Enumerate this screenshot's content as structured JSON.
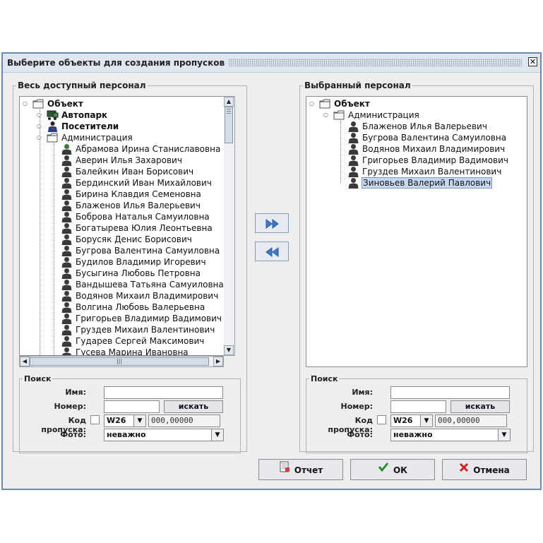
{
  "dialog": {
    "title": "Выберите объекты для создания пропусков",
    "close_glyph": "✕"
  },
  "left": {
    "title": "Весь доступный персонал",
    "tree": {
      "root": "Объект",
      "groups": [
        "Автопарк",
        "Посетители"
      ],
      "folder": "Администрация",
      "people": [
        "Абрамова Ирина Станиславовна",
        "Аверин Илья Захарович",
        "Балейкин Иван Борисович",
        "Бердинский Иван Михайлович",
        "Бирина Клавдия Семеновна",
        "Блаженов Илья Валерьевич",
        "Боброва Наталья Самуиловна",
        "Богатырева Юлия Леонтьевна",
        "Борусяк Денис Борисович",
        "Бугрова Валентина Самуиловна",
        "Будилов Владимир Игоревич",
        "Бусыгина Любовь Петровна",
        "Вандышева Татьяна Самуиловна",
        "Водянов Михаил Владимирович",
        "Волгина Любовь Валерьевна",
        "Григорьев Владимир Вадимович",
        "Груздев Михаил Валентинович",
        "Гударев Сергей Максимович",
        "Гусева Марина Ивановна"
      ]
    }
  },
  "right": {
    "title": "Выбранный персонал",
    "tree": {
      "root": "Объект",
      "folder": "Администрация",
      "people": [
        "Блаженов Илья Валерьевич",
        "Бугрова Валентина Самуиловна",
        "Водянов Михаил Владимирович",
        "Григорьев Владимир Вадимович",
        "Груздев Михаил Валентинович",
        "Зиновьев Валерий Павлович"
      ],
      "selected_index": 5
    }
  },
  "search": {
    "title": "Поиск",
    "name_label": "Имя:",
    "number_label": "Номер:",
    "search_button": "искать",
    "pass_label": "Код пропуска:",
    "pass_type": "W26",
    "pass_value": "000,00000",
    "photo_label": "Фото:",
    "photo_value": "неважно"
  },
  "buttons": {
    "report": "Отчет",
    "ok": "ОК",
    "cancel": "Отмена"
  },
  "icons": {
    "tree_handle": "handle-icon",
    "folder": "folder-icon",
    "person": "person-icon",
    "vehicle": "vehicle-icon",
    "visitor": "visitor-icon",
    "move_right": "double-arrow-right-icon",
    "move_left": "double-arrow-left-icon",
    "report": "report-icon",
    "ok": "checkmark-icon",
    "cancel": "red-x-icon"
  },
  "colors": {
    "title_bar": "#dfe6ef",
    "window_border": "#6a8ab4",
    "selection": "#c8d8f0",
    "ok_green": "#2e8b2e",
    "cancel_red": "#d02020"
  }
}
